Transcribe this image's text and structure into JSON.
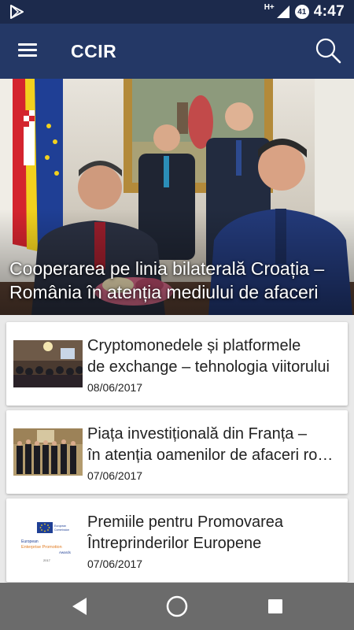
{
  "status_bar": {
    "network": "H+",
    "battery": "41",
    "time": "4:47"
  },
  "app_bar": {
    "title": "CCIR"
  },
  "hero": {
    "title": "Cooperarea pe linia bilaterală Croația – România în atenția mediului de afaceri"
  },
  "news": [
    {
      "title_lines": [
        "Cryptomonedele și platformele",
        "de exchange – tehnologia viitorului"
      ],
      "date": "08/06/2017"
    },
    {
      "title_lines": [
        "Piața investițională din Franța –",
        "în atenția oamenilor de afaceri români"
      ],
      "date": "07/06/2017"
    },
    {
      "title_lines": [
        "Premiile pentru Promovarea",
        "Întreprinderilor Europene"
      ],
      "date": "07/06/2017",
      "thumb_text": {
        "brand1": "European",
        "brand2": "Enterprise Promotion",
        "brand3": "Awards",
        "year": "2017",
        "flag1": "European",
        "flag2": "Commission"
      }
    }
  ],
  "colors": {
    "status_bar": "#1c2a4c",
    "app_bar": "#243866",
    "nav_bar": "#6b6b6b"
  }
}
